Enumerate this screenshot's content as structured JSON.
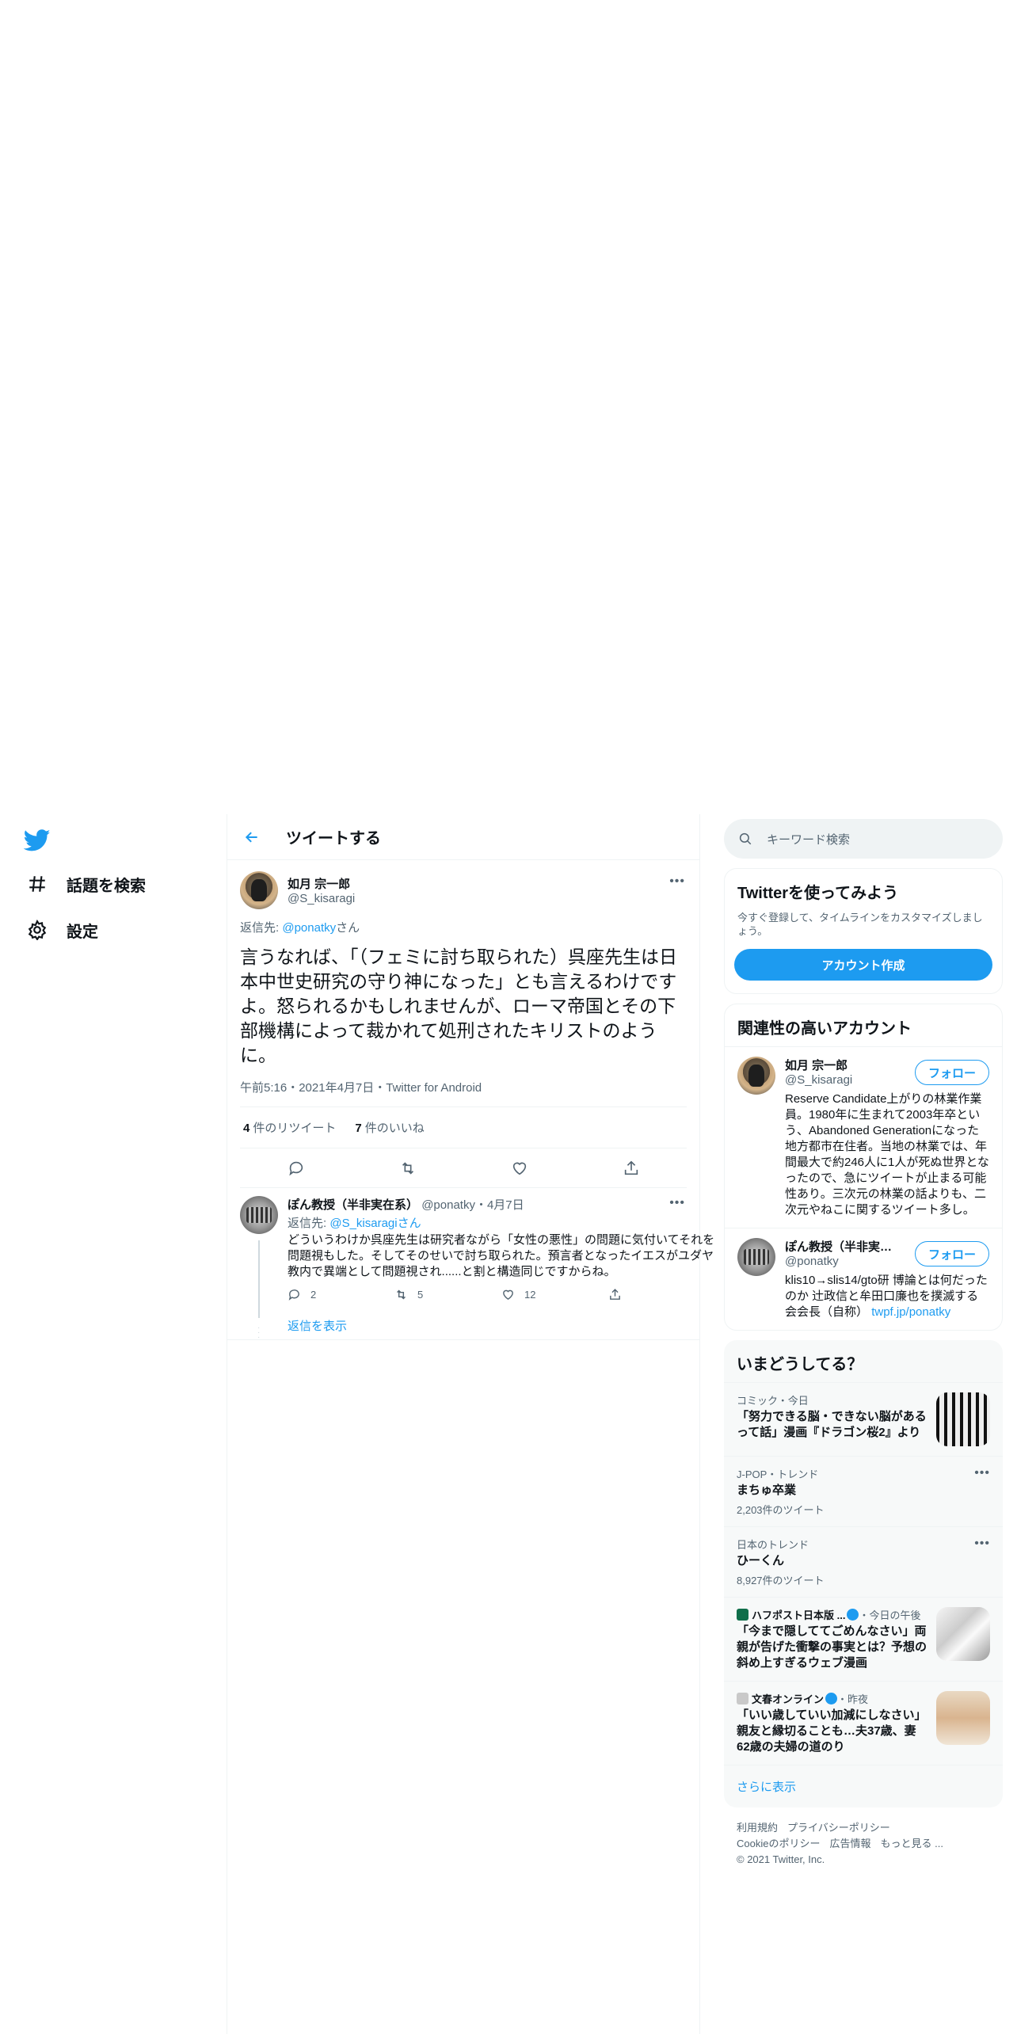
{
  "nav": {
    "explore_label": "話題を検索",
    "settings_label": "設定"
  },
  "header": {
    "title": "ツイートする"
  },
  "main_tweet": {
    "name": "如月 宗一郎",
    "handle": "@S_kisaragi",
    "reply_prefix": "返信先: ",
    "reply_to": "@ponatky",
    "reply_suffix": "さん",
    "text": "言うなれば、「（フェミに討ち取られた）呉座先生は日本中世史研究の守り神になった」とも言えるわけですよ。怒られるかもしれませんが、ローマ帝国とその下部機構によって裁かれて処刑されたキリストのように。",
    "meta": "午前5:16・2021年4月7日・Twitter for Android",
    "retweets": "4",
    "retweets_label": "件のリツイート",
    "likes": "7",
    "likes_label": "件のいいね"
  },
  "reply_tweet": {
    "name": "ぽん教授（半非実在系）",
    "handle": "@ponatky",
    "date": "・4月7日",
    "reply_prefix": "返信先: ",
    "reply_to": "@S_kisaragi",
    "reply_suffix": "さん",
    "text": "どういうわけか呉座先生は研究者ながら「女性の悪性」の問題に気付いてそれを問題視もした。そしてそのせいで討ち取られた。預言者となったイエスがユダヤ教内で異端として問題視され......と割と構造同じですからね。",
    "replies": "2",
    "retweets": "5",
    "likes": "12",
    "show_replies": "返信を表示"
  },
  "search": {
    "placeholder": "キーワード検索"
  },
  "signup": {
    "title": "Twitterを使ってみよう",
    "subtitle": "今すぐ登録して、タイムラインをカスタマイズしましょう。",
    "button": "アカウント作成"
  },
  "related": {
    "title": "関連性の高いアカウント",
    "follow_label": "フォロー",
    "accounts": [
      {
        "name": "如月 宗一郎",
        "handle": "@S_kisaragi",
        "bio": "Reserve Candidate上がりの林業作業員。1980年に生まれて2003年卒という、Abandoned Generationになった地方都市在住者。当地の林業では、年間最大で約246人に1人が死ぬ世界となったので、急にツイートが止まる可能性あり。三次元の林業の話よりも、二次元やねこに関するツイート多し。"
      },
      {
        "name": "ぽん教授（半非実在系）",
        "handle": "@ponatky",
        "bio": "klis10→slis14/gto研 博論とは何だったのか 辻政信と牟田口廉也を撲滅する会会長（自称）",
        "link": "twpf.jp/ponatky"
      }
    ]
  },
  "trends": {
    "title": "いまどうしてる？",
    "items": [
      {
        "meta": "コミック・今日",
        "title": "「努力できる脳・できない脳があるって話」漫画『ドラゴン桜2』より"
      },
      {
        "meta": "J-POP・トレンド",
        "title": "まちゅ卒業",
        "count": "2,203件のツイート"
      },
      {
        "meta": "日本のトレンド",
        "title": "ひーくん",
        "count": "8,927件のツイート"
      },
      {
        "source": "ハフポスト日本版 ...",
        "time": "・今日の午後",
        "title": "「今まで隠しててごめんなさい」両親が告げた衝撃の事実とは？予想の斜め上すぎるウェブ漫画"
      },
      {
        "source": "文春オンライン",
        "time": "・昨夜",
        "title": "「いい歳していい加減にしなさい」親友と縁切ることも…夫37歳、妻62歳の夫婦の道のり"
      }
    ],
    "show_more": "さらに表示"
  },
  "footer": {
    "terms": "利用規約",
    "privacy": "プライバシーポリシー",
    "cookies": "Cookieのポリシー",
    "ads": "広告情報",
    "more": "もっと見る ...",
    "copyright": "© 2021 Twitter, Inc."
  },
  "colors": {
    "accent": "#1d9bf0",
    "text": "#0f1419",
    "muted": "#536471",
    "border": "#eff3f4"
  }
}
